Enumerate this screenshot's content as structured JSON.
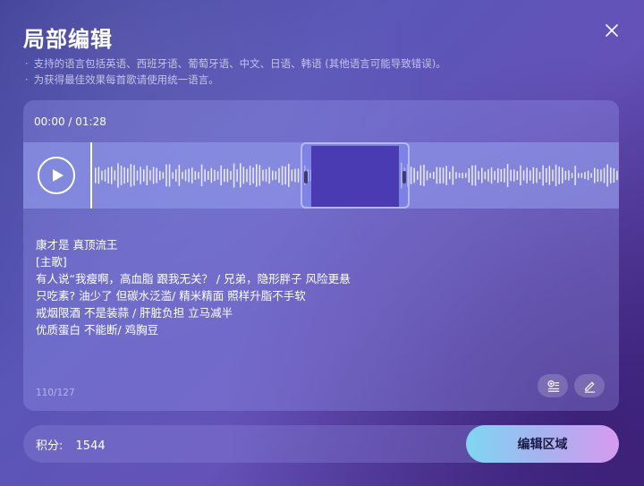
{
  "dialog": {
    "title": "局部编辑",
    "close_icon": "close-icon"
  },
  "tips": [
    "支持的语言包括英语、西班牙语、葡萄牙语、中文、日语、韩语 (其他语言可能导致错误)。",
    "为获得最佳效果每首歌请使用统一语言。"
  ],
  "player": {
    "time": "00:00 / 01:28",
    "play_icon": "play-icon",
    "progress": 0,
    "selection": {
      "start_fraction": 0.47,
      "end_fraction": 0.62
    }
  },
  "lyrics": {
    "lines": [
      "康才是 真顶流王",
      "[主歌]",
      "有人说“我瘦啊，高血脂 跟我无关？ / 兄弟，隐形胖子 风险更悬",
      "只吃素? 油少了 但碳水泛滥/ 精米精面 照样升脂不手软",
      "戒烟限酒 不是装蒜 / 肝脏负担 立马减半",
      "优质蛋白 不能断/ 鸡胸豆"
    ],
    "counter": "110/127"
  },
  "tools": {
    "insert_icon": "add-lyrics-icon",
    "edit_icon": "pencil-icon"
  },
  "footer": {
    "points_label": "积分:",
    "points_value": "1544",
    "edit_button": "编辑区域"
  },
  "colors": {
    "accent_selection": "#4a3bb3",
    "button_gradient_start": "#7fd6f2",
    "button_gradient_end": "#d69af0"
  }
}
